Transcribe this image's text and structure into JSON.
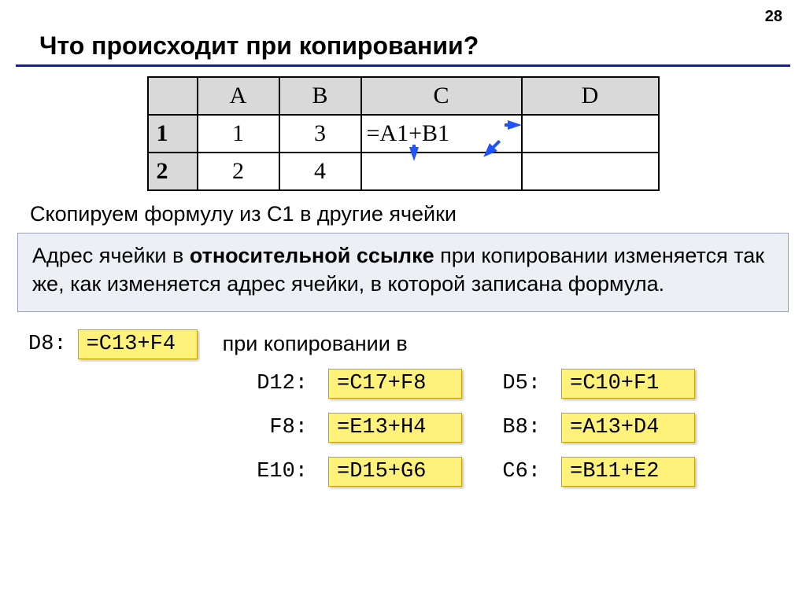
{
  "page_number": "28",
  "title": "Что происходит при копировании?",
  "table": {
    "columns": [
      "A",
      "B",
      "C",
      "D"
    ],
    "rows": [
      {
        "hdr": "1",
        "a": "1",
        "b": "3",
        "c": "=A1+B1",
        "d": ""
      },
      {
        "hdr": "2",
        "a": "2",
        "b": "4",
        "c": "",
        "d": ""
      }
    ]
  },
  "body_text": "Скопируем формулу из С1 в другие ячейки",
  "info_box": {
    "pre": "Адрес ячейки в ",
    "bold": "относительной ссылке",
    "post": " при копировании изменяется так же, как изменяется адрес ячейки, в которой записана формула."
  },
  "source": {
    "label": "D8:",
    "formula": "=C13+F4",
    "tail": "при копировании в"
  },
  "results": [
    {
      "cell": "D12:",
      "formula": "=C17+F8"
    },
    {
      "cell": "D5:",
      "formula": "=C10+F1"
    },
    {
      "cell": "F8:",
      "formula": "=E13+H4"
    },
    {
      "cell": "B8:",
      "formula": "=A13+D4"
    },
    {
      "cell": "E10:",
      "formula": "=D15+G6"
    },
    {
      "cell": "C6:",
      "formula": "=B11+E2"
    }
  ]
}
